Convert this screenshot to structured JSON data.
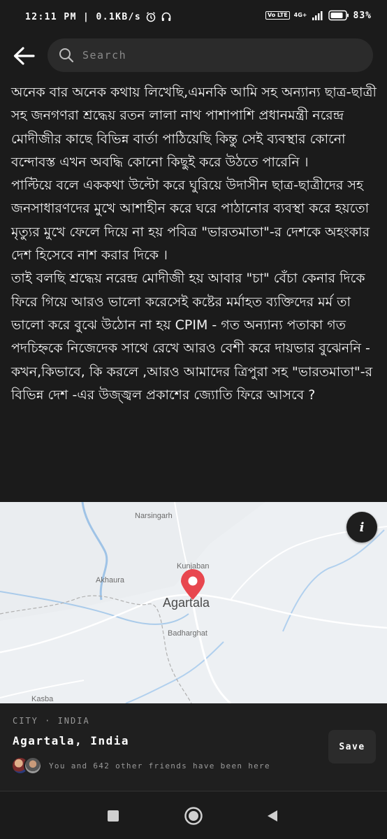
{
  "status_bar": {
    "time": "12:11 PM | 0.1KB/s",
    "volte": "Vo LTE",
    "network": "4G+",
    "battery": "83%"
  },
  "header": {
    "search_placeholder": "Search",
    "back_icon": "arrow-left-icon",
    "search_icon": "search-icon"
  },
  "post": {
    "paragraphs": [
      "অনেক বার অনেক কথায় লিখেছি,এমনকি আমি সহ অন্যান্য ছাত্র-ছাত্রী সহ জনগণরা শ্রদ্ধেয় রতন লালা নাথ পাশাপাশি প্রধানমন্ত্রী নরেন্দ্র মোদীজীর কাছে বিভিন্ন বার্তা পাঠিয়েছি কিন্তু সেই ব্যবস্থার কোনো বন্দোবস্ত এখন অবদ্ধি কোনো কিছুই করে উঠতে পারেনি ।",
      "পাল্টিয়ে বলে এককথা উল্টো করে ঘুরিয়ে উদাসীন ছাত্র-ছাত্রীদের সহ জনসাধারণদের মুখে আশাহীন করে ঘরে পাঠানোর ব্যবস্থা করে হয়তো মৃত্যুর মুখে ফেলে দিয়ে না হয় পবিত্র \"ভারতমাতা\"-র দেশকে অহংকার দেশ হিসেবে নাশ করার দিকে ।",
      "তাই বলছি শ্রদ্ধেয় নরেন্দ্র মোদীজী হয় আবার \"চা\" বেঁচা কেনার দিকে ফিরে গিয়ে আরও ভালো করেসেই কষ্টের মর্মাহত ব্যক্তিদের মর্ম তা ভালো করে বুঝে উঠোন না হয় CPIM - গত অন্যান্য পতাকা গত পদচিহ্নকে নিজেদেক সাথে রেখে আরও বেশী করে দায়ভার বুঝেননি - কখন,কিভাবে, কি করলে ,আরও আমাদের ত্রিপুরা সহ \"ভারতমাতা\"-র বিভিন্ন দেশ -এর উজ্জ্বল প্রকাশের জ্যোতি ফিরে আসবে ?"
    ]
  },
  "map": {
    "labels": {
      "narsingarh": "Narsingarh",
      "akhaura": "Akhaura",
      "kunjaban": "Kunjaban",
      "agartala": "Agartala",
      "badharghat": "Badharghat",
      "kasba": "Kasba"
    },
    "info_icon": "info-icon",
    "pin_color": "#e8474f"
  },
  "place": {
    "type": "CITY · INDIA",
    "name": "Agartala, India",
    "save_label": "Save",
    "friends_text": "You and 642 other friends have been here"
  },
  "nav": {
    "recents_icon": "square-icon",
    "home_icon": "circle-icon",
    "back_icon": "triangle-back-icon"
  }
}
